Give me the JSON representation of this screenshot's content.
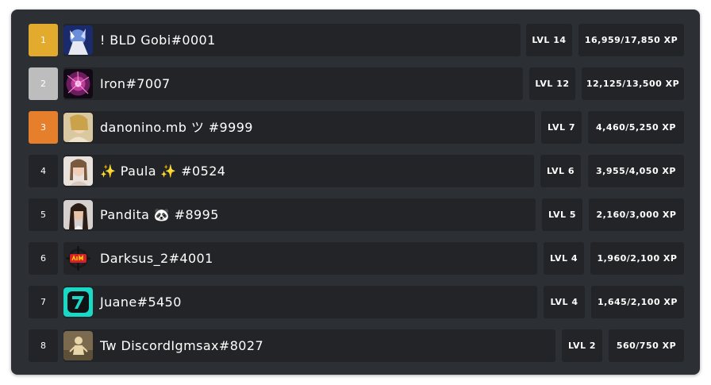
{
  "leaderboard": {
    "rows": [
      {
        "rank": "1",
        "name": "! BLD Gobi",
        "tag": "#0001",
        "level": "LVL 14",
        "xp": "16,959/17,850 XP"
      },
      {
        "rank": "2",
        "name": "Iron",
        "tag": "#7007",
        "level": "LVL 12",
        "xp": "12,125/13,500 XP"
      },
      {
        "rank": "3",
        "name": "danonino.mb ツ",
        "tag": "#9999",
        "level": "LVL 7",
        "xp": "4,460/5,250 XP"
      },
      {
        "rank": "4",
        "name": "✨ Paula ✨",
        "tag": "#0524",
        "level": "LVL 6",
        "xp": "3,955/4,050 XP"
      },
      {
        "rank": "5",
        "name": "Pandita 🐼",
        "tag": "#8995",
        "level": "LVL 5",
        "xp": "2,160/3,000 XP"
      },
      {
        "rank": "6",
        "name": "Darksus_2",
        "tag": "#4001",
        "level": "LVL 4",
        "xp": "1,960/2,100 XP"
      },
      {
        "rank": "7",
        "name": "Juane",
        "tag": "#5450",
        "level": "LVL 4",
        "xp": "1,645/2,100 XP"
      },
      {
        "rank": "8",
        "name": "Tw DiscordIgmsax",
        "tag": "#8027",
        "level": "LVL 2",
        "xp": "560/750 XP"
      }
    ]
  },
  "colors": {
    "panel": "#2c2f33",
    "cell": "#222427",
    "gold": "#e3ab2e",
    "silver": "#bdbdbd",
    "bronze": "#e57f2c",
    "text": "#ffffff"
  }
}
